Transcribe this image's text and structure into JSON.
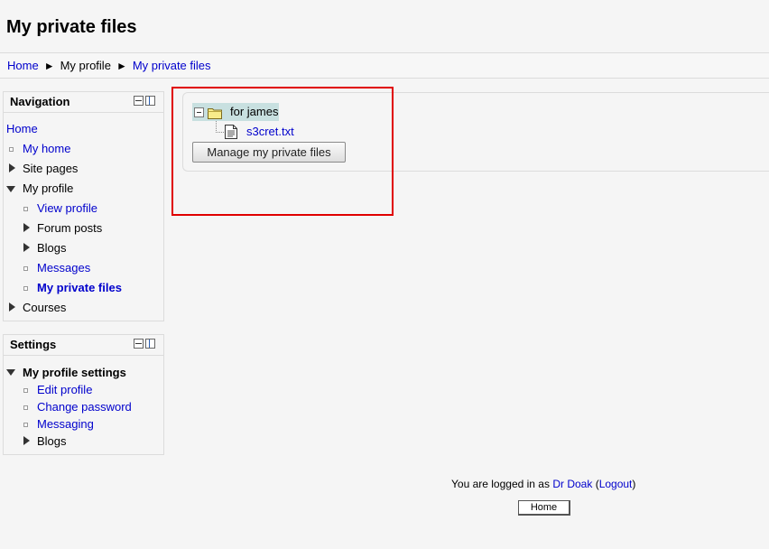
{
  "page": {
    "title": "My private files"
  },
  "breadcrumb": {
    "items": [
      "Home",
      "My profile",
      "My private files"
    ],
    "separator": "►"
  },
  "navigation": {
    "title": "Navigation",
    "items": [
      {
        "label": "Home",
        "kind": "link"
      },
      {
        "label": "My home",
        "kind": "link"
      },
      {
        "label": "Site pages",
        "kind": "collapsed"
      },
      {
        "label": "My profile",
        "kind": "expanded"
      },
      {
        "label": "View profile",
        "kind": "link"
      },
      {
        "label": "Forum posts",
        "kind": "collapsed"
      },
      {
        "label": "Blogs",
        "kind": "collapsed"
      },
      {
        "label": "Messages",
        "kind": "link"
      },
      {
        "label": "My private files",
        "kind": "current"
      },
      {
        "label": "Courses",
        "kind": "collapsed"
      }
    ]
  },
  "settings": {
    "title": "Settings",
    "items": [
      {
        "label": "My profile settings",
        "kind": "expanded"
      },
      {
        "label": "Edit profile",
        "kind": "link"
      },
      {
        "label": "Change password",
        "kind": "link"
      },
      {
        "label": "Messaging",
        "kind": "link"
      },
      {
        "label": "Blogs",
        "kind": "collapsed"
      }
    ]
  },
  "files": {
    "folder_name": "for james",
    "file_name": "s3cret.txt",
    "manage_button": "Manage my private files"
  },
  "footer": {
    "logged_in_prefix": "You are logged in as",
    "user_name": "Dr Doak",
    "logout_label": "Logout",
    "home_button": "Home"
  },
  "colors": {
    "link": "#0000cc",
    "highlight": "#e00000",
    "folder_highlight": "#c8e0e0"
  },
  "icons": [
    "block-minimize-icon",
    "block-dock-icon",
    "expand-triangle-icon",
    "collapse-triangle-icon",
    "folder-icon",
    "text-file-icon",
    "tree-collapse-icon"
  ]
}
